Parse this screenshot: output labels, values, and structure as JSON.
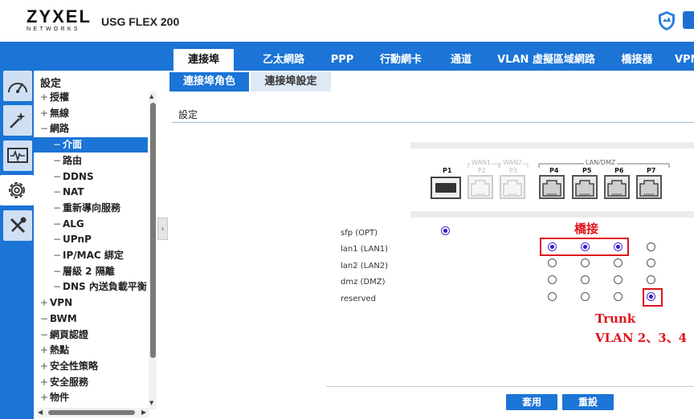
{
  "header": {
    "logo_main": "ZYXEL",
    "logo_sub": "NETWORKS",
    "model": "USG FLEX 200"
  },
  "icons": {
    "dashboard": "dashboard-gauge-icon",
    "wizard": "magic-wand-icon",
    "monitor": "monitor-pulse-icon",
    "configuration": "gear-icon",
    "maintenance": "tools-icon",
    "shield": "shield-icon"
  },
  "nav": {
    "title": "設定",
    "items": [
      {
        "sym": "+",
        "label": "授權",
        "indent": 0
      },
      {
        "sym": "+",
        "label": "無線",
        "indent": 0
      },
      {
        "sym": "−",
        "label": "網路",
        "indent": 0
      },
      {
        "sym": "−",
        "label": "介面",
        "indent": 1,
        "selected": true
      },
      {
        "sym": "−",
        "label": "路由",
        "indent": 1
      },
      {
        "sym": "−",
        "label": "DDNS",
        "indent": 1
      },
      {
        "sym": "−",
        "label": "NAT",
        "indent": 1
      },
      {
        "sym": "−",
        "label": "重新導向服務",
        "indent": 1
      },
      {
        "sym": "−",
        "label": "ALG",
        "indent": 1
      },
      {
        "sym": "−",
        "label": "UPnP",
        "indent": 1
      },
      {
        "sym": "−",
        "label": "IP/MAC 綁定",
        "indent": 1
      },
      {
        "sym": "−",
        "label": "層級 2 隔離",
        "indent": 1
      },
      {
        "sym": "−",
        "label": "DNS 內送負載平衡",
        "indent": 1
      },
      {
        "sym": "+",
        "label": "VPN",
        "indent": 0
      },
      {
        "sym": "−",
        "label": "BWM",
        "indent": 0
      },
      {
        "sym": "−",
        "label": "網頁認證",
        "indent": 0
      },
      {
        "sym": "+",
        "label": "熱點",
        "indent": 0
      },
      {
        "sym": "+",
        "label": "安全性策略",
        "indent": 0
      },
      {
        "sym": "+",
        "label": "安全服務",
        "indent": 0
      },
      {
        "sym": "+",
        "label": "物件",
        "indent": 0
      }
    ]
  },
  "tabs": [
    {
      "label": "連接埠",
      "active": true
    },
    {
      "label": "乙太網路"
    },
    {
      "label": "PPP"
    },
    {
      "label": "行動網卡"
    },
    {
      "label": "通道"
    },
    {
      "label": "VLAN 虛擬區域網路"
    },
    {
      "label": "橋接器"
    },
    {
      "label": "VPN"
    }
  ],
  "subtabs": [
    {
      "label": "連接埠角色",
      "active": true
    },
    {
      "label": "連接埠設定"
    }
  ],
  "section_title": "設定",
  "panel": {
    "groups": [
      "WAN1",
      "WAN2",
      "LAN/DMZ"
    ],
    "ports": [
      {
        "label": "P1",
        "enabled": true,
        "kind": "sfp"
      },
      {
        "label": "P2",
        "enabled": false
      },
      {
        "label": "P3",
        "enabled": false
      },
      {
        "label": "P4",
        "enabled": true
      },
      {
        "label": "P5",
        "enabled": true
      },
      {
        "label": "P6",
        "enabled": true
      },
      {
        "label": "P7",
        "enabled": true
      }
    ]
  },
  "roles": [
    {
      "label": "sfp (OPT)",
      "P1": true
    },
    {
      "label": "lan1 (LAN1)",
      "P4": true,
      "P5": true,
      "P6": true,
      "P7": false
    },
    {
      "label": "lan2 (LAN2)",
      "P4": false,
      "P5": false,
      "P6": false,
      "P7": false
    },
    {
      "label": "dmz (DMZ)",
      "P4": false,
      "P5": false,
      "P6": false,
      "P7": false
    },
    {
      "label": "reserved",
      "P4": false,
      "P5": false,
      "P6": false,
      "P7": true
    }
  ],
  "annotations": {
    "bridge": "橋接",
    "trunk": "Trunk",
    "vlan": "VLAN 2、3、4"
  },
  "buttons": {
    "apply": "套用",
    "reset": "重設"
  },
  "colors": {
    "accent": "#1b74d6",
    "annotation": "#e0141b",
    "radio_selected": "#3a1fc9"
  }
}
